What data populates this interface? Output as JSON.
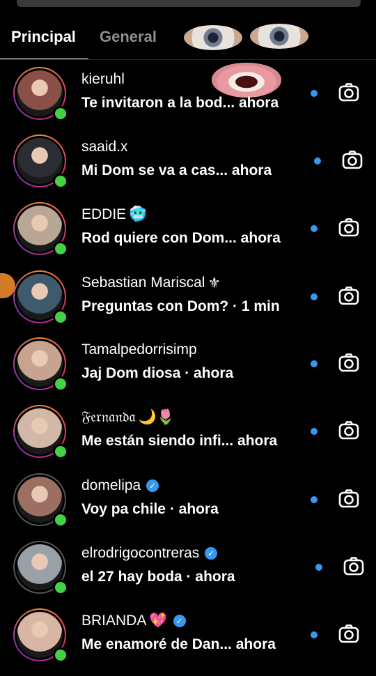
{
  "tabs": {
    "primary": "Principal",
    "general": "General"
  },
  "colors": {
    "unread_dot": "#3897f0",
    "online": "#44d145",
    "verified": "#3897f0"
  },
  "conversations": [
    {
      "name": "kieruhl",
      "message": "Te invitaron a la bod... ahora",
      "verified": false,
      "online": true,
      "unread": true,
      "story_ring": "gradient",
      "avatar_color": "#8a5048"
    },
    {
      "name": "saaid.x",
      "message": "Mi Dom se va a cas...   ahora",
      "verified": false,
      "online": true,
      "unread": true,
      "story_ring": "gradient",
      "avatar_color": "#2c2c34"
    },
    {
      "name": "EDDIE",
      "message": "Rod quiere con Dom... ahora",
      "verified": false,
      "online": true,
      "unread": true,
      "story_ring": "gradient",
      "avatar_color": "#b9a695",
      "name_emoji": "cold-face-emoji"
    },
    {
      "name": "Sebastian Mariscal",
      "message": "Preguntas con Dom? · 1 min",
      "verified": false,
      "online": true,
      "unread": true,
      "story_ring": "gradient",
      "avatar_color": "#3f5a6c",
      "name_emoji": "fleur-de-lis-emoji"
    },
    {
      "name": "Tamalpedorrisimp",
      "message": "Jaj Dom diosa · ahora",
      "verified": false,
      "online": true,
      "unread": true,
      "story_ring": "gradient",
      "avatar_color": "#c8a490"
    },
    {
      "name": "𝔉𝔢𝔯𝔫𝔞𝔫𝔡𝔞",
      "message": "Me están siendo infi... ahora",
      "verified": false,
      "online": true,
      "unread": true,
      "story_ring": "gradient",
      "avatar_color": "#d2b8a6",
      "name_emoji": "moon-tulip-emoji"
    },
    {
      "name": "domelipa",
      "message": "Voy pa chile · ahora",
      "verified": true,
      "online": true,
      "unread": true,
      "story_ring": "gray",
      "avatar_color": "#9d6e62"
    },
    {
      "name": "elrodrigocontreras",
      "message": "el 27 hay boda · ahora",
      "verified": true,
      "online": true,
      "unread": true,
      "story_ring": "gray",
      "avatar_color": "#9aa1a6"
    },
    {
      "name": "BRIANDA",
      "message": "Me enamoré de Dan... ahora",
      "verified": true,
      "online": true,
      "unread": true,
      "story_ring": "gradient",
      "avatar_color": "#d7b6a4",
      "name_emoji": "sparkling-heart-emoji"
    }
  ],
  "verified_glyph": "✓",
  "emoji_text": {
    "cold-face-emoji": "🥶",
    "fleur-de-lis-emoji": "⚜",
    "moon-tulip-emoji": "🌙🌷",
    "sparkling-heart-emoji": "💖"
  }
}
